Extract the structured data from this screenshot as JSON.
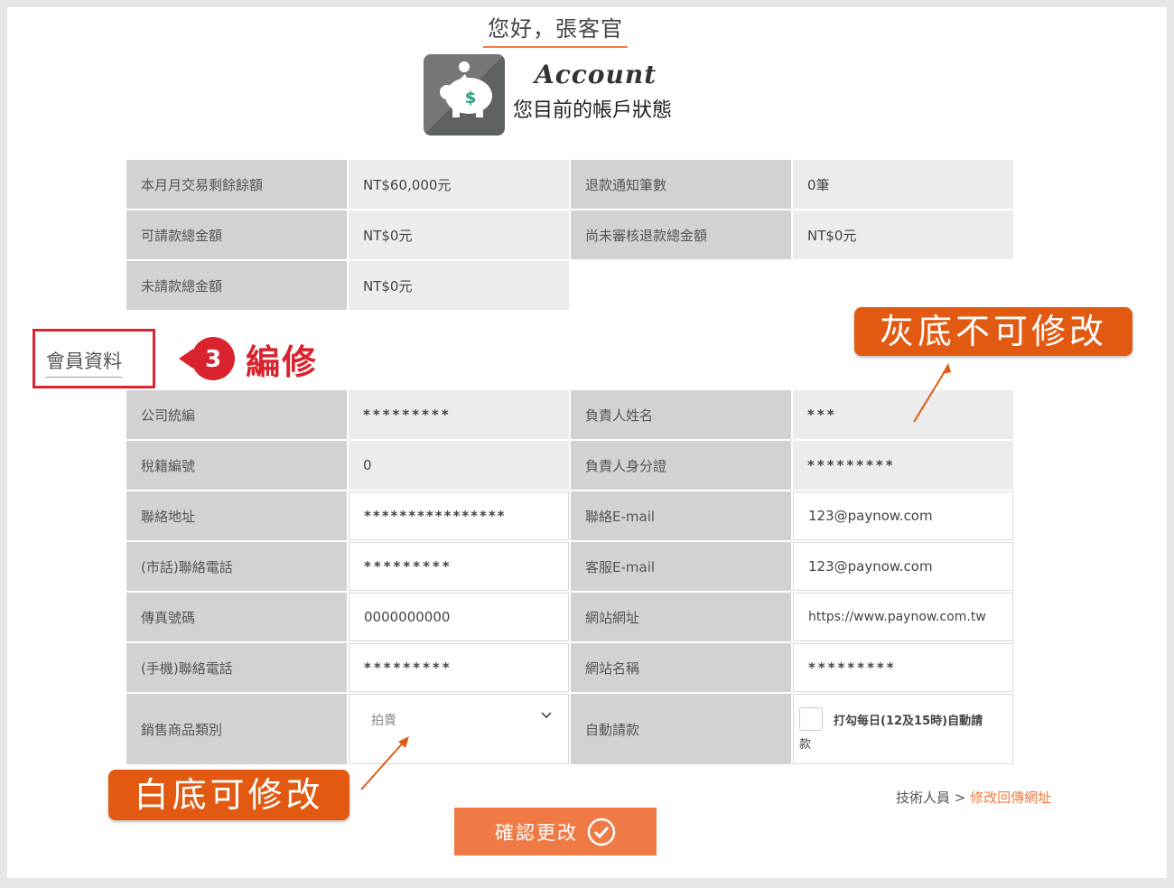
{
  "header": {
    "greeting": "您好，張客官",
    "account_title": "Account",
    "account_subtitle": "您目前的帳戶狀態"
  },
  "summary": [
    {
      "label": "本月月交易剩餘餘額",
      "value": "NT$60,000元",
      "label2": "退款通知筆數",
      "value2": "0筆"
    },
    {
      "label": "可請款總金額",
      "value": "NT$0元",
      "label2": "尚未審核退款總金額",
      "value2": "NT$0元"
    },
    {
      "label": "未請款總金額",
      "value": "NT$0元"
    }
  ],
  "member": {
    "section_title": "會員資料",
    "step_number": "3",
    "step_label": "編修",
    "rows": [
      {
        "label": "公司統編",
        "value": "*********",
        "label2": "負責人姓名",
        "value2": "***"
      },
      {
        "label": "稅籍編號",
        "value": "0",
        "label2": "負責人身分證",
        "value2": "*********"
      },
      {
        "label": "聯絡地址",
        "value": "****************",
        "label2": "聯絡E-mail",
        "value2": "123@paynow.com"
      },
      {
        "label": "(市話)聯絡電話",
        "value": "*********",
        "label2": "客服E-mail",
        "value2": "123@paynow.com"
      },
      {
        "label": "傳真號碼",
        "value": "0000000000",
        "label2": "網站網址",
        "value2": "https://www.paynow.com.tw"
      },
      {
        "label": "(手機)聯絡電話",
        "value": "*********",
        "label2": "網站名稱",
        "value2": "*********"
      }
    ],
    "category_label": "銷售商品類別",
    "category_value": "拍賣",
    "auto_label": "自動請款",
    "auto_text": "打勾每日(12及15時)自動請",
    "auto_text2": "款",
    "auto_checked": false
  },
  "annotations": {
    "gray_note": "灰底不可修改",
    "white_note": "白底可修改",
    "color": "#e25a12"
  },
  "footer": {
    "tech_prefix": "技術人員 > ",
    "tech_link": "修改回傳網址",
    "confirm_label": "確認更改"
  }
}
